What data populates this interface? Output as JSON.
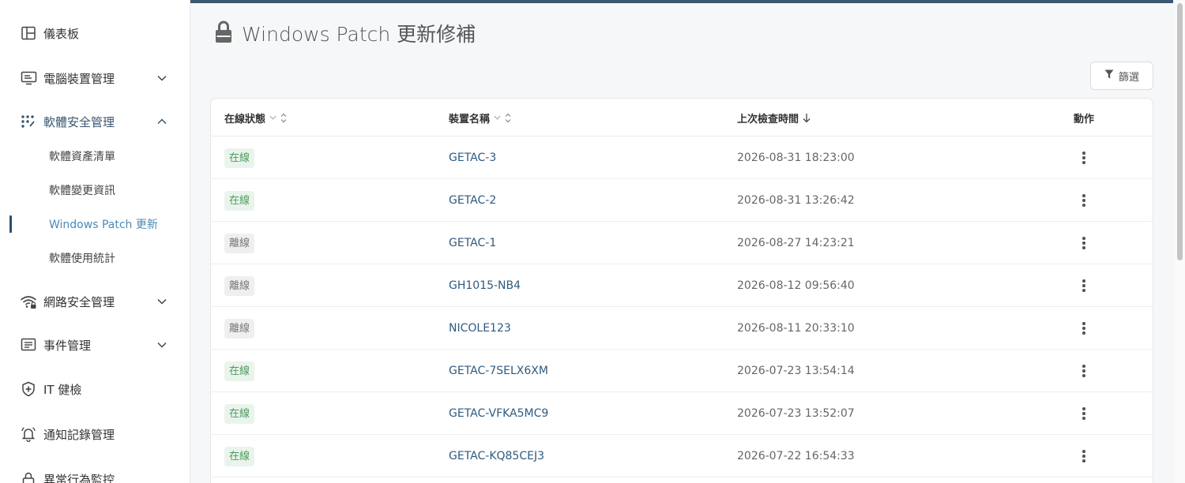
{
  "sidebar": {
    "items": [
      {
        "label": "儀表板",
        "icon": "layout-icon"
      },
      {
        "label": "電腦裝置管理",
        "icon": "monitor-icon",
        "expandable": true,
        "expanded": false
      },
      {
        "label": "軟體安全管理",
        "icon": "apps-dots-icon",
        "expandable": true,
        "expanded": true,
        "children": [
          {
            "label": "軟體資產清單"
          },
          {
            "label": "軟體變更資訊"
          },
          {
            "label": "Windows Patch 更新",
            "active": true
          },
          {
            "label": "軟體使用統計"
          }
        ]
      },
      {
        "label": "網路安全管理",
        "icon": "wifi-lock-icon",
        "expandable": true,
        "expanded": false
      },
      {
        "label": "事件管理",
        "icon": "list-icon",
        "expandable": true,
        "expanded": false
      },
      {
        "label": "IT 健檢",
        "icon": "shield-plus-icon"
      },
      {
        "label": "通知記錄管理",
        "icon": "bell-icon"
      },
      {
        "label": "異常行為監控",
        "icon": "lock-icon"
      }
    ]
  },
  "page": {
    "title": "Windows Patch 更新修補",
    "title_icon": "lock-icon"
  },
  "toolbar": {
    "filter_label": "篩選"
  },
  "table": {
    "columns": {
      "status": "在線狀態",
      "device": "裝置名稱",
      "last_check": "上次檢查時間",
      "action": "動作"
    },
    "sort": {
      "column": "last_check",
      "direction": "desc"
    },
    "rows": [
      {
        "status": "在線",
        "online": true,
        "device": "GETAC-3",
        "time": "2026-08-31 18:23:00"
      },
      {
        "status": "在線",
        "online": true,
        "device": "GETAC-2",
        "time": "2026-08-31 13:26:42"
      },
      {
        "status": "離線",
        "online": false,
        "device": "GETAC-1",
        "time": "2026-08-27 14:23:21"
      },
      {
        "status": "離線",
        "online": false,
        "device": "GH1015-NB4",
        "time": "2026-08-12 09:56:40"
      },
      {
        "status": "離線",
        "online": false,
        "device": "NICOLE123",
        "time": "2026-08-11 20:33:10"
      },
      {
        "status": "在線",
        "online": true,
        "device": "GETAC-7SELX6XM",
        "time": "2026-07-23 13:54:14"
      },
      {
        "status": "在線",
        "online": true,
        "device": "GETAC-VFKA5MC9",
        "time": "2026-07-23 13:52:07"
      },
      {
        "status": "在線",
        "online": true,
        "device": "GETAC-KQ85CEJ3",
        "time": "2026-07-22 16:54:33"
      }
    ]
  },
  "colors": {
    "accent": "#3a5670",
    "active_link": "#4a8ab5",
    "online_text": "#4a9a5d",
    "online_bg": "#eaf4ec",
    "offline_text": "#777777",
    "offline_bg": "#efefef"
  }
}
